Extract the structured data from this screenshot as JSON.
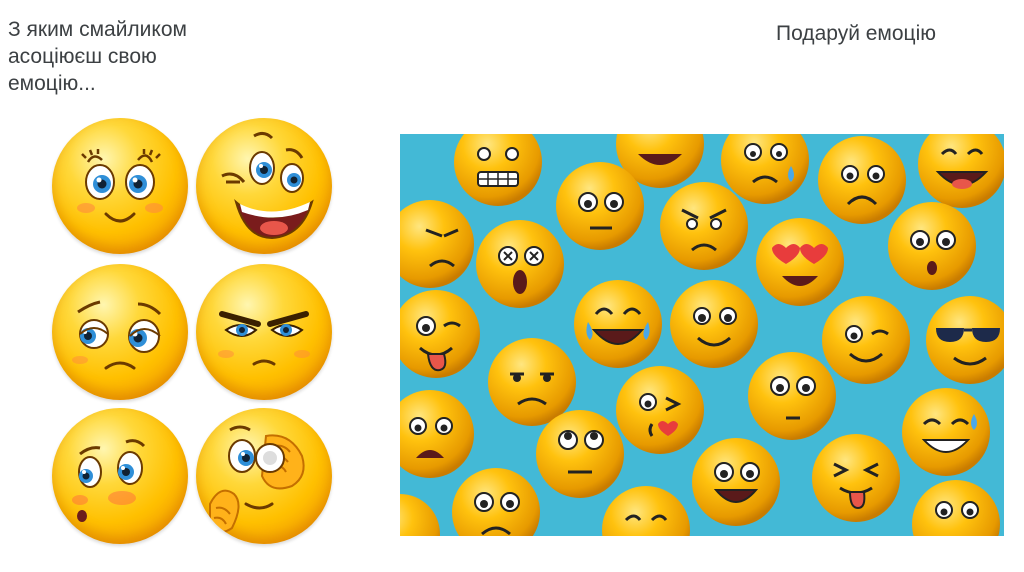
{
  "question": {
    "text": "З яким смайликом\nасоціюєш свою\nемоцію..."
  },
  "gift": {
    "label": "Подаруй емоцію"
  },
  "emoji_grid": {
    "items": [
      {
        "icon": "happy-eyelashes-emoji-icon"
      },
      {
        "icon": "winking-laughing-emoji-icon"
      },
      {
        "icon": "sad-worried-emoji-icon"
      },
      {
        "icon": "angry-frowning-emoji-icon"
      },
      {
        "icon": "surprised-blushing-emoji-icon"
      },
      {
        "icon": "shy-covering-eye-emoji-icon"
      }
    ]
  },
  "emoji_photo": {
    "icon": "emoji-collection-photo"
  },
  "colors": {
    "text": "#3c4043",
    "emoji_yellow": "#ffc000",
    "photo_background": "#43b9d6"
  }
}
